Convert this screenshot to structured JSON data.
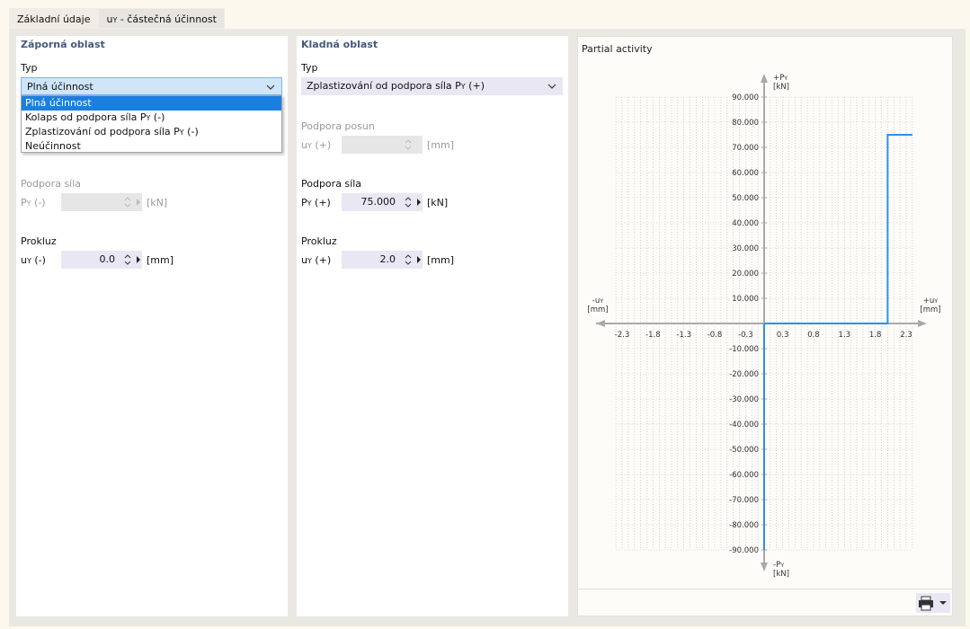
{
  "tabs": [
    {
      "label": "Základní údaje"
    },
    {
      "label_main": "u",
      "label_sub": "Y",
      "label_rest": " - částečná účinnost"
    }
  ],
  "negative": {
    "title": "Záporná oblast",
    "typ_label": "Typ",
    "typ_value": "Plná účinnost",
    "dropdown_options": [
      "Plná účinnost",
      "Kolaps od podpora síla P",
      "Zplastizování od podpora síla P",
      "Neúčinnost"
    ],
    "dropdown_suffix": [
      "",
      " (-)",
      " (-)",
      ""
    ],
    "force_section": "Podpora síla",
    "force_symbol": "P",
    "force_suffix": " (-)",
    "force_value": "",
    "force_unit": "[kN]",
    "slip_section": "Prokluz",
    "slip_symbol": "u",
    "slip_suffix": " (-)",
    "slip_value": "0.0",
    "slip_unit": "[mm]"
  },
  "positive": {
    "title": "Kladná oblast",
    "typ_label": "Typ",
    "typ_value_main": "Zplastizování od podpora síla P",
    "typ_value_suffix": " (+)",
    "disp_section": "Podpora posun",
    "disp_symbol": "u",
    "disp_suffix": " (+)",
    "disp_value": "",
    "disp_unit": "[mm]",
    "force_section": "Podpora síla",
    "force_symbol": "P",
    "force_suffix": " (+)",
    "force_value": "75.000",
    "force_unit": "[kN]",
    "slip_section": "Prokluz",
    "slip_symbol": "u",
    "slip_suffix": " (+)",
    "slip_value": "2.0",
    "slip_unit": "[mm]"
  },
  "chart": {
    "title": "Partial activity",
    "y_top_label": "+P",
    "y_top_sub": "Y",
    "y_top_unit": "[kN]",
    "y_bot_label": "-P",
    "y_bot_sub": "Y",
    "y_bot_unit": "[kN]",
    "x_left_label": "-u",
    "x_left_sub": "Y",
    "x_left_unit": "[mm]",
    "x_right_label": "+u",
    "x_right_sub": "Y",
    "x_right_unit": "[mm]"
  },
  "chart_data": {
    "type": "line",
    "title": "Partial activity",
    "xlabel": "u",
    "ylabel": "P",
    "x_ticks": [
      "-2.3",
      "-1.8",
      "-1.3",
      "-0.8",
      "-0.3",
      "0.3",
      "0.8",
      "1.3",
      "1.8",
      "2.3"
    ],
    "x_tick_values": [
      -2.3,
      -1.8,
      -1.3,
      -0.8,
      -0.3,
      0.3,
      0.8,
      1.3,
      1.8,
      2.3
    ],
    "y_ticks": [
      "90.000",
      "80.000",
      "70.000",
      "60.000",
      "50.000",
      "40.000",
      "30.000",
      "20.000",
      "10.000",
      "-10.000",
      "-20.000",
      "-30.000",
      "-40.000",
      "-50.000",
      "-60.000",
      "-70.000",
      "-80.000",
      "-90.000"
    ],
    "y_tick_values": [
      90,
      80,
      70,
      60,
      50,
      40,
      30,
      20,
      10,
      -10,
      -20,
      -30,
      -40,
      -50,
      -60,
      -70,
      -80,
      -90
    ],
    "xlim": [
      -2.6,
      2.6
    ],
    "ylim": [
      -90,
      90
    ],
    "grid": true,
    "series": [
      {
        "x": [
          0,
          0
        ],
        "y": [
          -90,
          0
        ],
        "color": "#2f8fe6"
      },
      {
        "x": [
          0,
          2.0,
          2.0,
          2.4
        ],
        "y": [
          0,
          0,
          75,
          75
        ],
        "color": "#2f8fe6"
      }
    ]
  },
  "colors": {
    "accent": "#1a7fe0",
    "series": "#2f8fe6",
    "section_title": "#45587c"
  },
  "icons": {
    "print": "printer-icon",
    "dropdown": "chevron-down-icon"
  }
}
